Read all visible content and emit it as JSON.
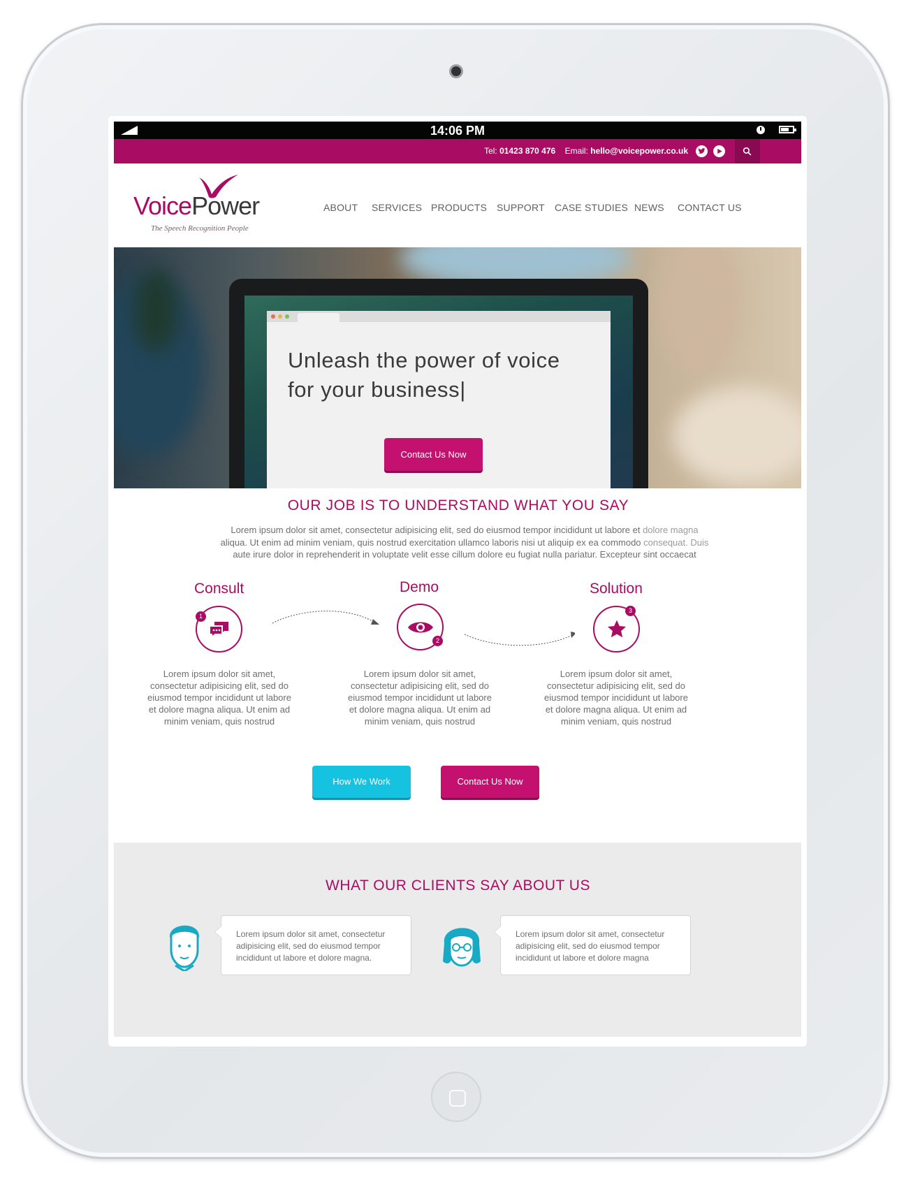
{
  "statusbar": {
    "time": "14:06 PM"
  },
  "topbar": {
    "tel_label": "Tel:",
    "tel": "01423 870 476",
    "email_label": "Email:",
    "email": "hello@voicepower.co.uk"
  },
  "brand": {
    "name_voice": "Voice",
    "name_power": "Power",
    "tagline": "The Speech Recognition People",
    "color_primary": "#a80c63",
    "color_accent": "#15c3e0"
  },
  "nav": {
    "items": [
      {
        "label": "ABOUT"
      },
      {
        "label": "SERVICES"
      },
      {
        "label": "PRODUCTS"
      },
      {
        "label": "SUPPORT"
      },
      {
        "label": "CASE STUDIES"
      },
      {
        "label": "NEWS"
      },
      {
        "label": "CONTACT US"
      }
    ]
  },
  "hero": {
    "title": "Unleash the power of voice\nfor your business|",
    "button": "Contact Us Now"
  },
  "intro": {
    "title": "OUR JOB IS TO UNDERSTAND WHAT YOU SAY",
    "body_a": "Lorem ipsum dolor sit amet, consectetur adipisicing elit, sed do eiusmod tempor incididunt ut labore et ",
    "body_fade_1": "dolore magna",
    "body_b": "aliqua. Ut enim ad minim veniam, quis nostrud exercitation ullamco laboris nisi ut aliquip ex ea commodo ",
    "body_fade_2": "consequat. Duis",
    "body_c": "aute irure dolor in reprehenderit in voluptate velit esse cillum dolore eu fugiat nulla pariatur. Excepteur sint occaecat"
  },
  "steps": [
    {
      "label": "Consult",
      "number": "1",
      "icon": "chat-icon",
      "text": "Lorem ipsum dolor sit amet, consectetur adipisicing elit, sed do eiusmod tempor incididunt ut labore et dolore magna aliqua. Ut enim ad minim veniam, quis nostrud"
    },
    {
      "label": "Demo",
      "number": "2",
      "icon": "eye-icon",
      "text": "Lorem ipsum dolor sit amet, consectetur adipisicing elit, sed do eiusmod tempor incididunt ut labore et dolore magna aliqua. Ut enim ad minim veniam, quis nostrud"
    },
    {
      "label": "Solution",
      "number": "3",
      "icon": "star-icon",
      "text": "Lorem ipsum dolor sit amet, consectetur adipisicing elit, sed do eiusmod tempor incididunt ut labore et dolore magna aliqua. Ut enim ad minim veniam, quis nostrud"
    }
  ],
  "actions": {
    "how_we_work": "How We Work",
    "contact": "Contact Us Now"
  },
  "testimonials": {
    "title": "WHAT OUR CLIENTS SAY ABOUT US",
    "items": [
      {
        "avatar": "male-avatar",
        "text": "Lorem ipsum dolor sit amet, consectetur adipisicing elit, sed do eiusmod tempor incididunt ut labore et dolore magna."
      },
      {
        "avatar": "female-avatar",
        "text": "Lorem ipsum dolor sit amet, consectetur adipisicing elit, sed do eiusmod tempor incididunt ut labore et dolore magna"
      }
    ]
  }
}
